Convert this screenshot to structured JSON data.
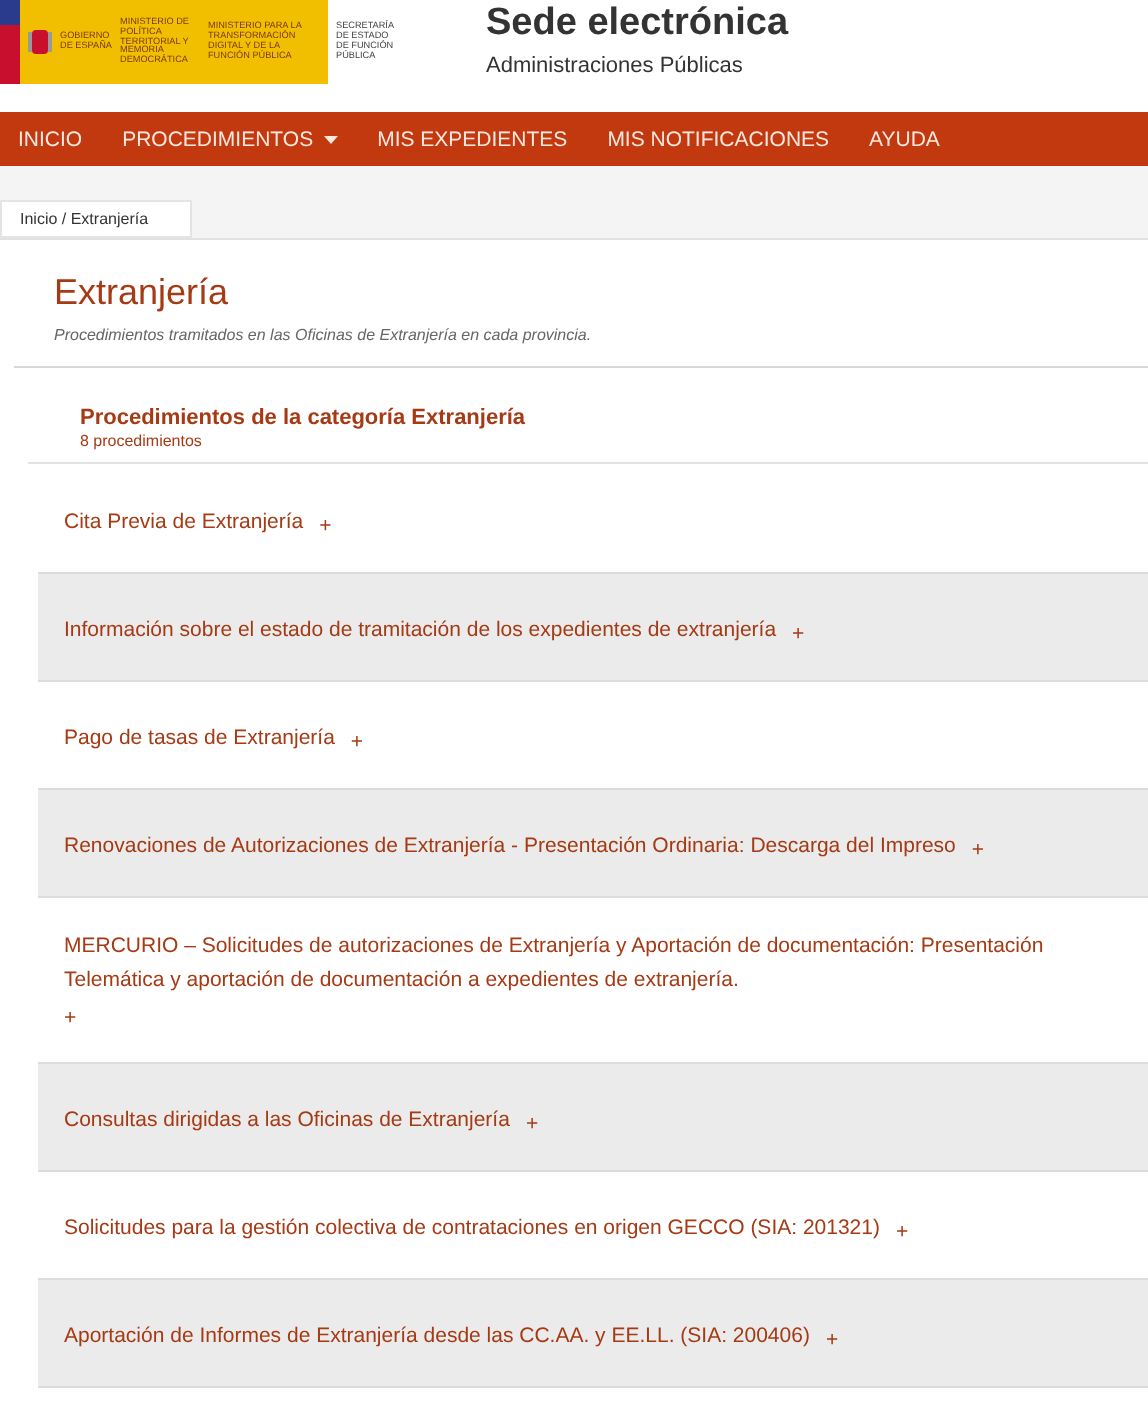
{
  "header": {
    "logo": {
      "government": "GOBIERNO DE ESPAÑA",
      "ministry_1": "MINISTERIO DE POLÍTICA TERRITORIAL Y MEMORIA DEMOCRÁTICA",
      "ministry_2": "MINISTERIO PARA LA TRANSFORMACIÓN DIGITAL Y DE LA FUNCIÓN PÚBLICA",
      "secretariat": "SECRETARÍA DE ESTADO DE FUNCIÓN PÚBLICA"
    },
    "title": "Sede electrónica",
    "subtitle": "Administraciones Públicas"
  },
  "nav": [
    {
      "label": "INICIO",
      "dropdown": false
    },
    {
      "label": "PROCEDIMIENTOS",
      "dropdown": true
    },
    {
      "label": "MIS EXPEDIENTES",
      "dropdown": false
    },
    {
      "label": "MIS NOTIFICACIONES",
      "dropdown": false
    },
    {
      "label": "AYUDA",
      "dropdown": false
    }
  ],
  "breadcrumb": "Inicio / Extranjería",
  "page": {
    "title": "Extranjería",
    "description": "Procedimientos tramitados en las Oficinas de Extranjería en cada provincia."
  },
  "category": {
    "title": "Procedimientos de la categoría Extranjería",
    "count": "8 procedimientos"
  },
  "procedures": [
    {
      "title": "Cita Previa de Extranjería",
      "toggle": "+"
    },
    {
      "title": "Información sobre el estado de tramitación de los expedientes de extranjería",
      "toggle": "+"
    },
    {
      "title": "Pago de tasas de Extranjería",
      "toggle": "+"
    },
    {
      "title": "Renovaciones de Autorizaciones de Extranjería - Presentación Ordinaria: Descarga del Impreso",
      "toggle": "+"
    },
    {
      "title": "MERCURIO – Solicitudes de autorizaciones de Extranjería y Aportación de documentación: Presentación Telemática y aportación de documentación a expedientes de extranjería.",
      "toggle": "+"
    },
    {
      "title": "Consultas dirigidas a las Oficinas de Extranjería",
      "toggle": "+"
    },
    {
      "title": "Solicitudes para la gestión colectiva de contrataciones en origen GECCO (SIA: 201321)",
      "toggle": "+"
    },
    {
      "title": "Aportación de Informes de Extranjería desde las CC.AA. y EE.LL. (SIA: 200406)",
      "toggle": "+"
    }
  ]
}
